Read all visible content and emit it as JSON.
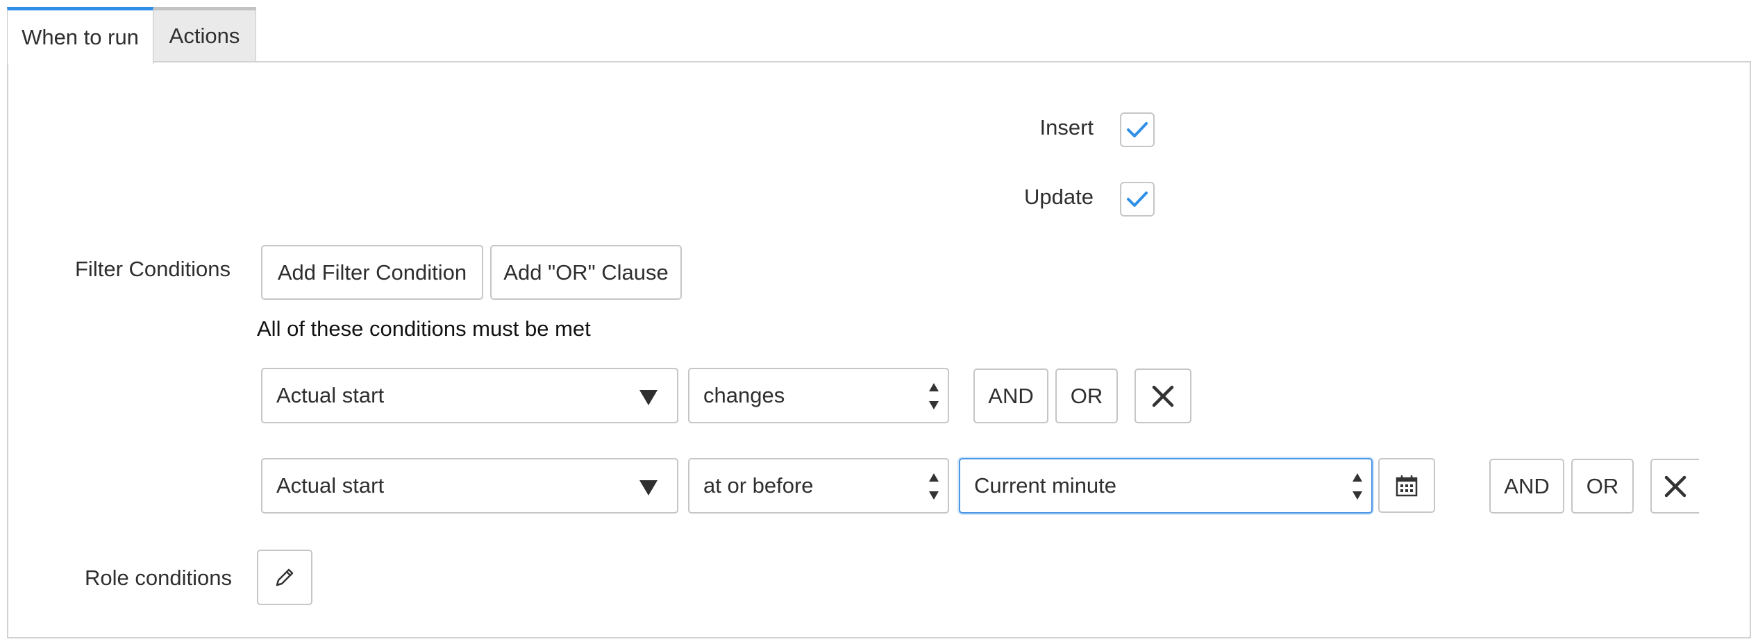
{
  "tabs": [
    {
      "label": "When to run",
      "active": true
    },
    {
      "label": "Actions",
      "active": false
    }
  ],
  "when_to_run": {
    "insert": {
      "label": "Insert",
      "checked": true
    },
    "update": {
      "label": "Update",
      "checked": true
    },
    "filter_conditions": {
      "label": "Filter Conditions",
      "add_filter_label": "Add Filter Condition",
      "add_or_label": "Add \"OR\" Clause",
      "summary": "All of these conditions must be met",
      "rows": [
        {
          "field": "Actual start",
          "operator": "changes",
          "and_label": "AND",
          "or_label": "OR"
        },
        {
          "field": "Actual start",
          "operator": "at or before",
          "value": "Current minute",
          "and_label": "AND",
          "or_label": "OR"
        }
      ]
    },
    "role_conditions": {
      "label": "Role conditions"
    }
  },
  "colors": {
    "accent": "#2f8fe8",
    "check": "#2f8fe8",
    "focus_border": "#4a97e6"
  },
  "icons": {
    "checkbox_check": "checkmark-icon",
    "remove": "close-icon",
    "calendar": "calendar-icon",
    "edit": "pencil-icon",
    "dropdown": "caret-down-icon",
    "select": "updown-arrows-icon"
  }
}
